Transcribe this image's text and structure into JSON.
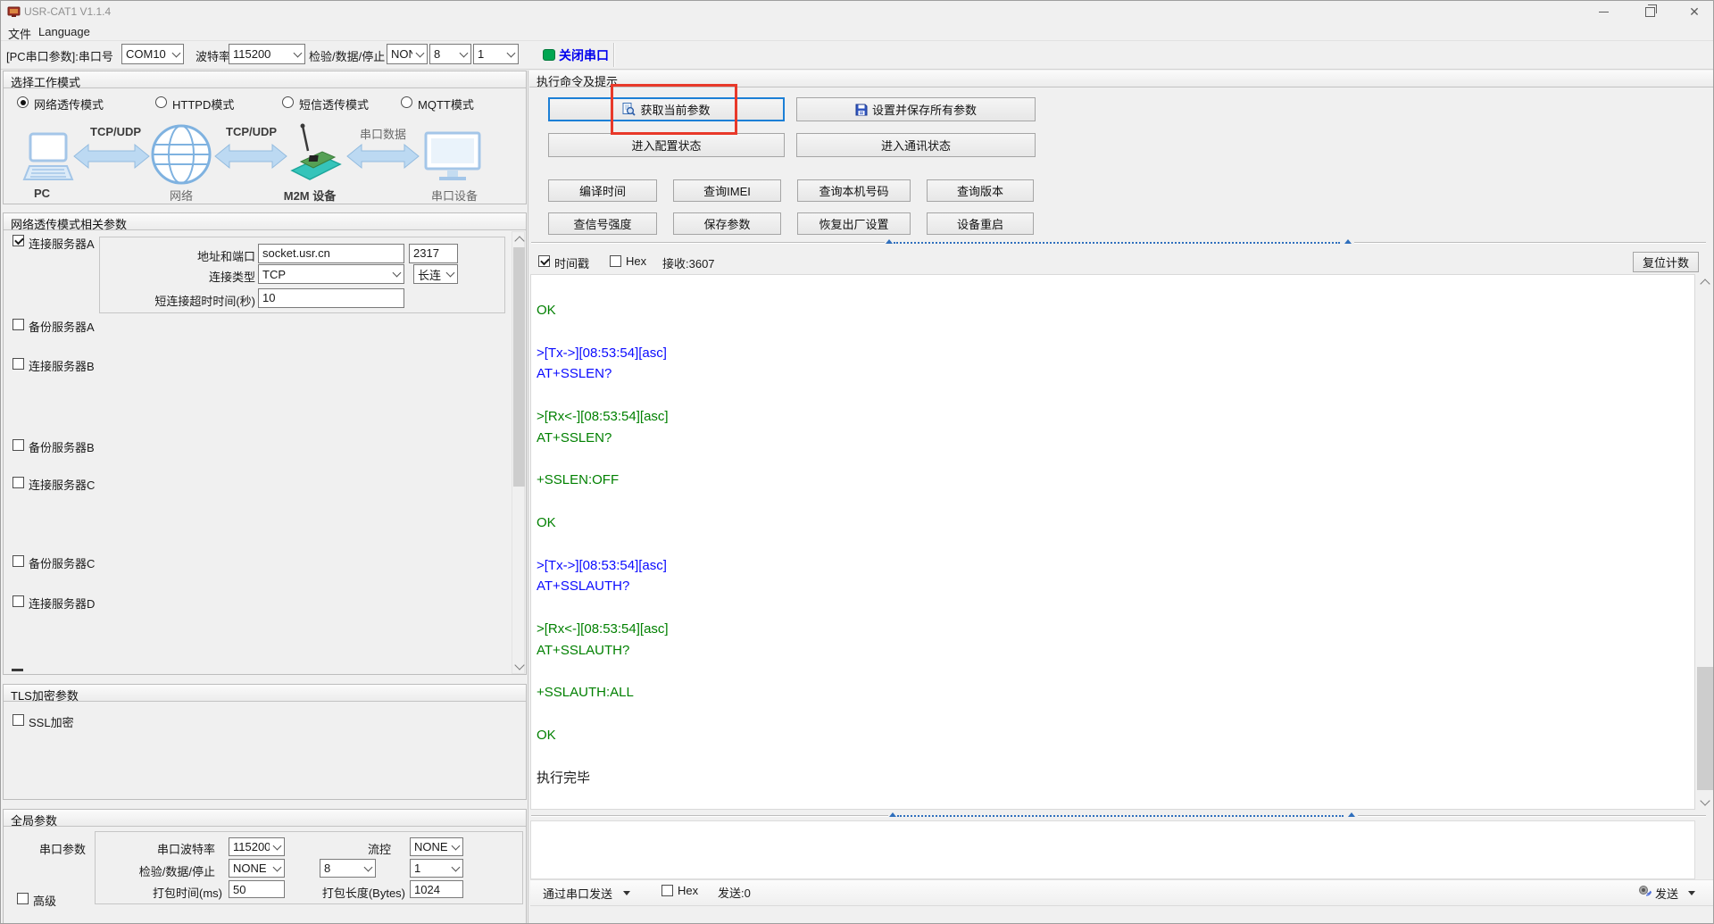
{
  "window": {
    "title": "USR-CAT1 V1.1.4"
  },
  "menu": {
    "file": "文件",
    "language": "Language"
  },
  "toolbar": {
    "pc_label": "[PC串口参数]:串口号",
    "com": "COM10",
    "baud_label": "波特率",
    "baud": "115200",
    "parity_label": "检验/数据/停止",
    "parity": "NONI",
    "databits": "8",
    "stopbits": "1",
    "close_port": "关闭串口"
  },
  "mode": {
    "title": "选择工作模式",
    "options": [
      "网络透传模式",
      "HTTPD模式",
      "短信透传模式",
      "MQTT模式"
    ],
    "diagram": {
      "node1": "PC",
      "node2": "网络",
      "node3": "M2M 设备",
      "node4": "串口设备",
      "link1": "TCP/UDP",
      "link2": "TCP/UDP",
      "link3": "串口数据"
    }
  },
  "net": {
    "title": "网络透传模式相关参数",
    "server_a": "连接服务器A",
    "addr_label": "地址和端口",
    "addr": "socket.usr.cn",
    "port": "2317",
    "type_label": "连接类型",
    "type": "TCP",
    "conn_mode": "长连",
    "timeout_label": "短连接超时时间(秒)",
    "timeout": "10",
    "checkboxes": [
      "备份服务器A",
      "连接服务器B",
      "备份服务器B",
      "连接服务器C",
      "备份服务器C",
      "连接服务器D"
    ]
  },
  "tls": {
    "title": "TLS加密参数",
    "ssl": "SSL加密"
  },
  "global": {
    "title": "全局参数",
    "serial": "串口参数",
    "baud_label": "串口波特率",
    "baud": "115200",
    "flow_label": "流控",
    "flow": "NONE",
    "parity_label": "检验/数据/停止",
    "parity": "NONE",
    "databits": "8",
    "stopbits": "1",
    "packtime_label": "打包时间(ms)",
    "packtime": "50",
    "packlen_label": "打包长度(Bytes)",
    "packlen": "1024",
    "advanced": "高级"
  },
  "cmd": {
    "title": "执行命令及提示",
    "get": "获取当前参数",
    "setsave": "设置并保存所有参数",
    "config": "进入配置状态",
    "comm": "进入通讯状态",
    "row3": [
      "编译时间",
      "查询IMEI",
      "查询本机号码",
      "查询版本"
    ],
    "row4": [
      "查信号强度",
      "保存参数",
      "恢复出厂设置",
      "设备重启"
    ]
  },
  "log": {
    "timestamp": "时间戳",
    "hex": "Hex",
    "recv": "接收:3607",
    "reset": "复位计数",
    "lines": [
      {
        "t": "OK",
        "c": "g"
      },
      {
        "t": "",
        "c": "g"
      },
      {
        "t": ">[Tx->][08:53:54][asc]",
        "c": "b"
      },
      {
        "t": "AT+SSLEN?",
        "c": "b"
      },
      {
        "t": "",
        "c": "g"
      },
      {
        "t": ">[Rx<-][08:53:54][asc]",
        "c": "g"
      },
      {
        "t": "AT+SSLEN?",
        "c": "g"
      },
      {
        "t": "",
        "c": "g"
      },
      {
        "t": "+SSLEN:OFF",
        "c": "g"
      },
      {
        "t": "",
        "c": "g"
      },
      {
        "t": "OK",
        "c": "g"
      },
      {
        "t": "",
        "c": "g"
      },
      {
        "t": ">[Tx->][08:53:54][asc]",
        "c": "b"
      },
      {
        "t": "AT+SSLAUTH?",
        "c": "b"
      },
      {
        "t": "",
        "c": "g"
      },
      {
        "t": ">[Rx<-][08:53:54][asc]",
        "c": "g"
      },
      {
        "t": "AT+SSLAUTH?",
        "c": "g"
      },
      {
        "t": "",
        "c": "g"
      },
      {
        "t": "+SSLAUTH:ALL",
        "c": "g"
      },
      {
        "t": "",
        "c": "g"
      },
      {
        "t": "OK",
        "c": "g"
      },
      {
        "t": "",
        "c": "g"
      },
      {
        "t": "执行完毕",
        "c": "k"
      }
    ]
  },
  "send": {
    "via": "通过串口发送",
    "hex": "Hex",
    "sent": "发送:0",
    "send": "发送"
  },
  "colors": {
    "accent_blue": "#0000ee",
    "log_green": "#008000",
    "log_blue": "#0a0aff",
    "red_annotation": "#e8392a",
    "green_dot": "#00a651"
  }
}
